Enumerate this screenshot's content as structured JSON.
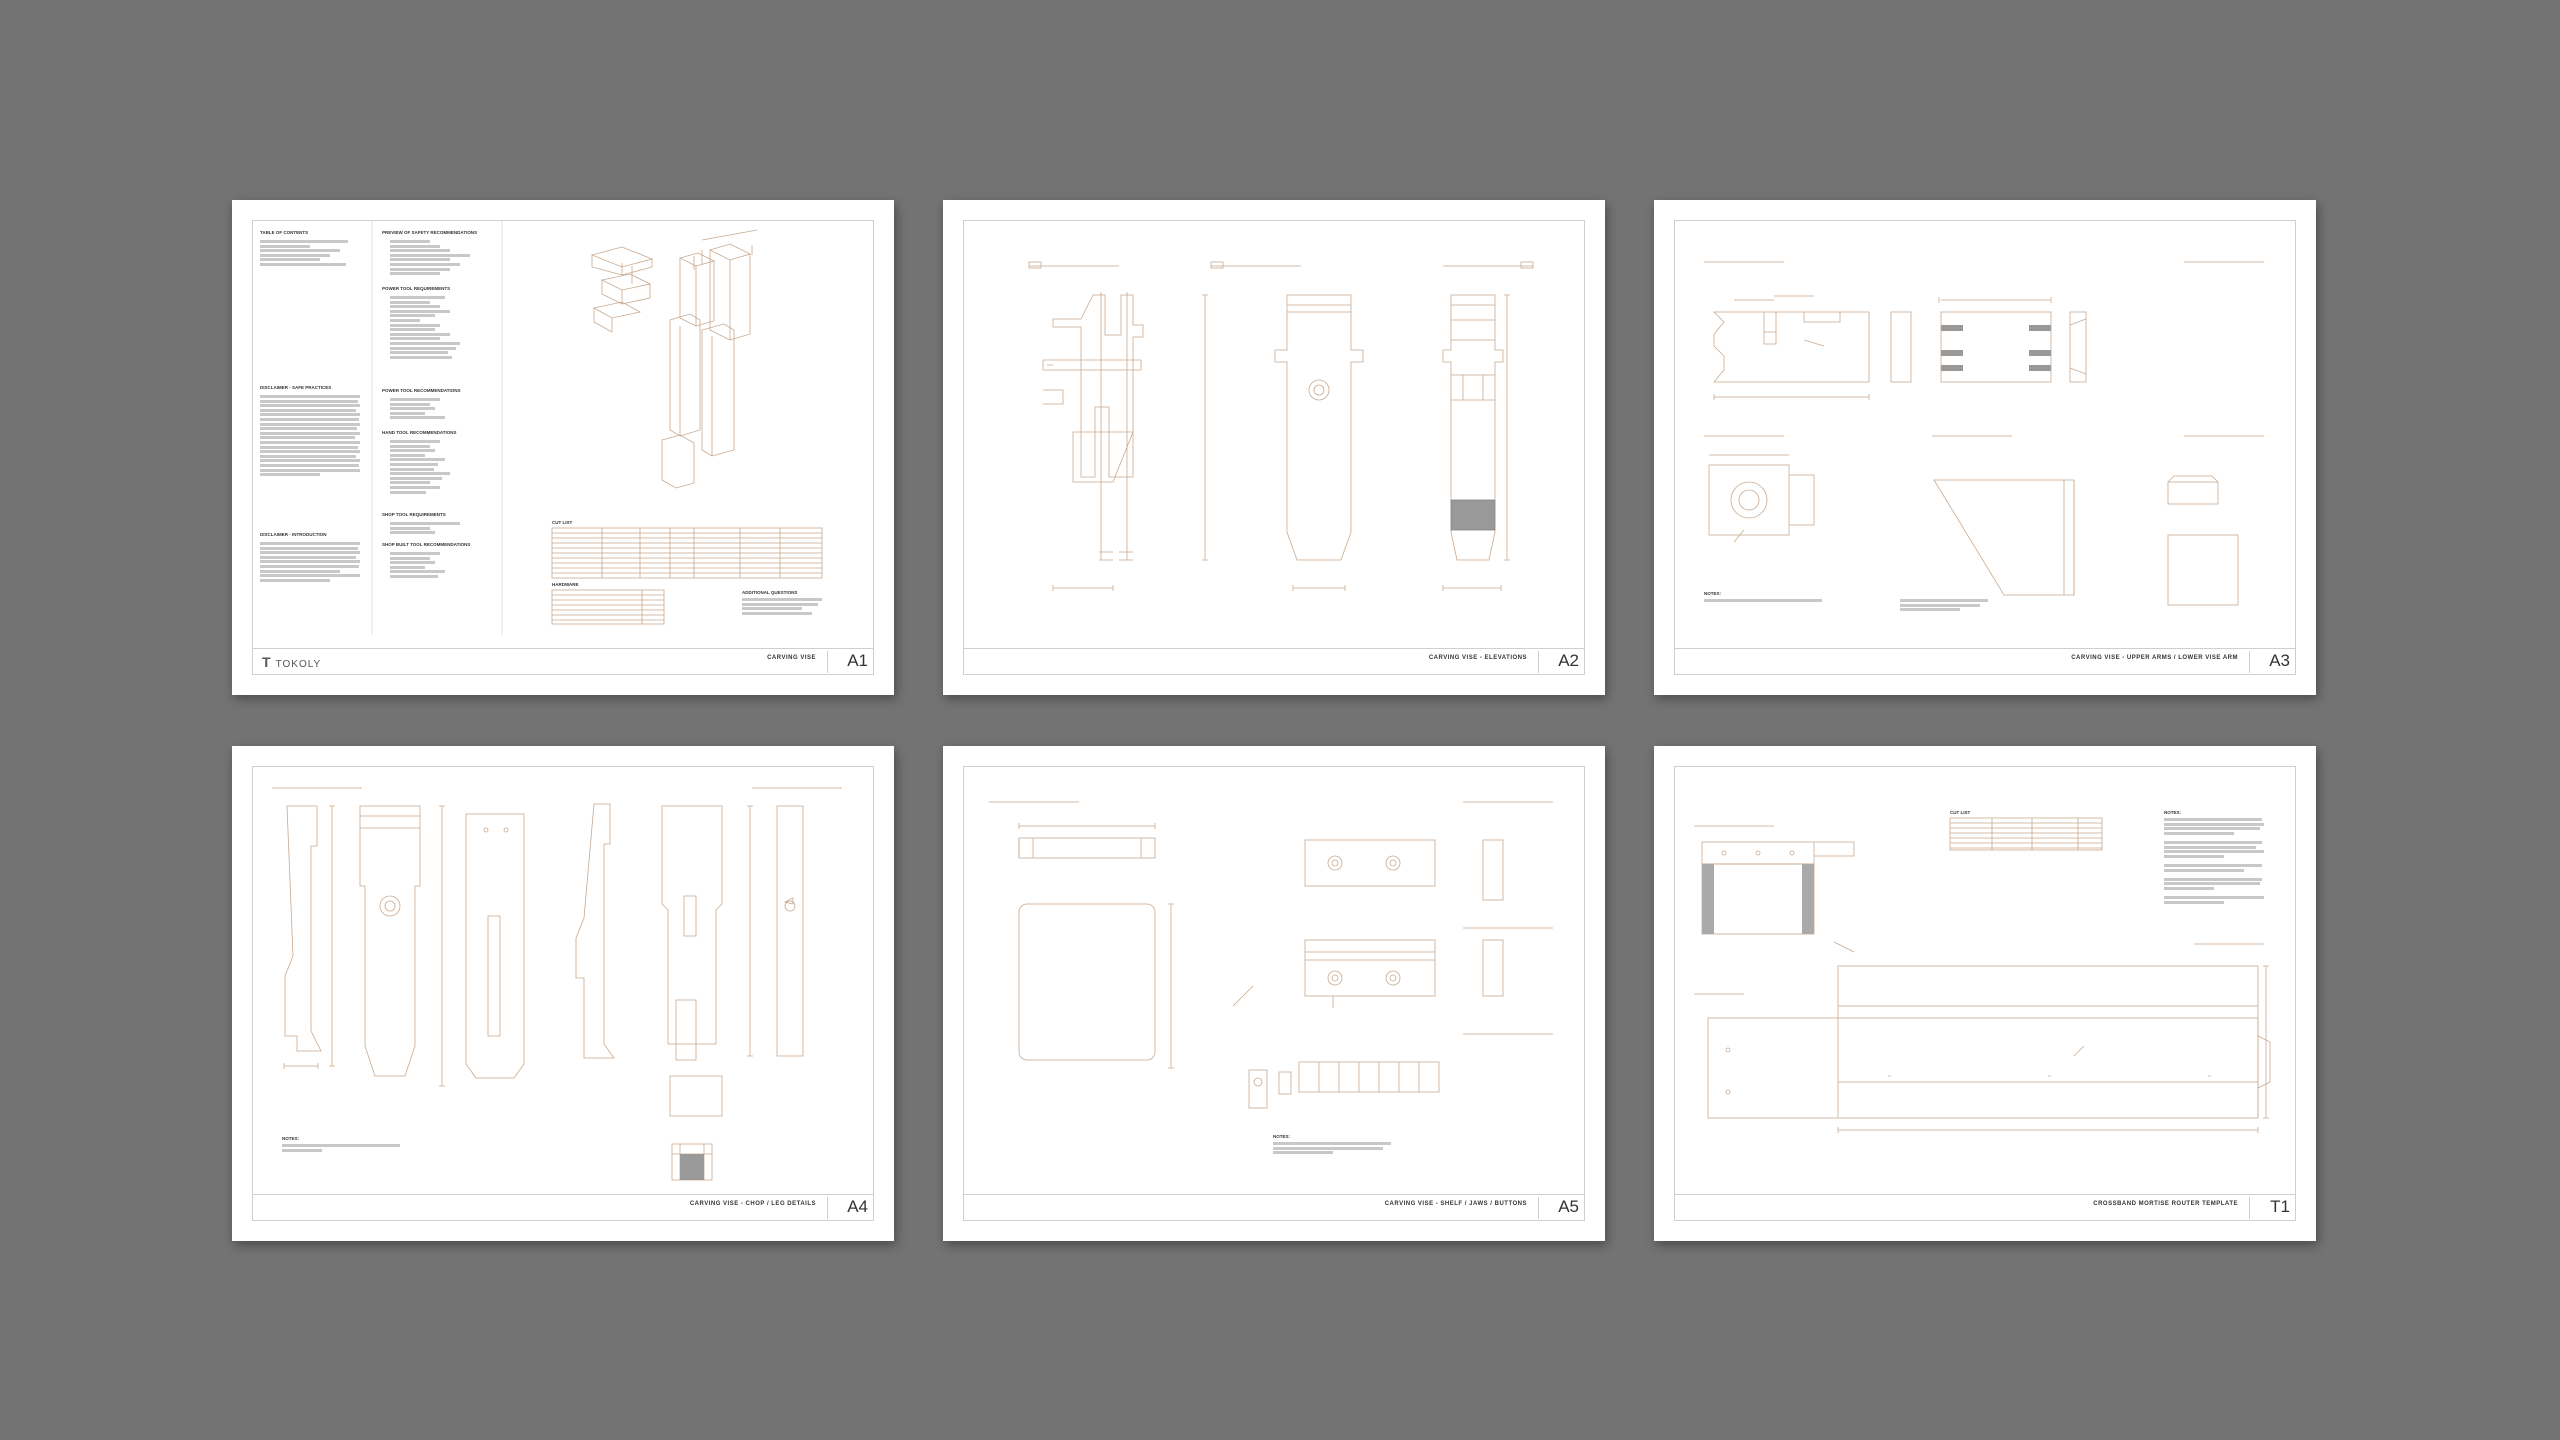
{
  "colors": {
    "background": "#737373",
    "sheet": "#ffffff",
    "line": "#c9a98e",
    "frame": "#cfcfcf"
  },
  "sheets": [
    {
      "number": "A1",
      "title": "CARVING VISE",
      "logo": "TOKOLY",
      "toc_heading": "TABLE OF CONTENTS",
      "headings": [
        "PREVIEW OF SAFETY RECOMMENDATIONS",
        "POWER TOOL REQUIREMENTS",
        "POWER TOOL RECOMMENDATIONS",
        "HAND TOOL RECOMMENDATIONS",
        "SHOP TOOL REQUIREMENTS",
        "SHOP BUILT TOOL RECOMMENDATIONS"
      ],
      "disclaimer_heading": "DISCLAIMER - SAFE PRACTICES",
      "intro_heading": "DISCLAIMER - INTRODUCTION",
      "cut_list_heading": "CUT LIST",
      "hardware_heading": "HARDWARE",
      "questions_heading": "ADDITIONAL QUESTIONS"
    },
    {
      "number": "A2",
      "title": "CARVING VISE - ELEVATIONS"
    },
    {
      "number": "A3",
      "title": "CARVING VISE - UPPER ARMS / LOWER VISE ARM",
      "notes_heading": "NOTES:"
    },
    {
      "number": "A4",
      "title": "CARVING VISE - CHOP / LEG DETAILS",
      "notes_heading": "NOTES:"
    },
    {
      "number": "A5",
      "title": "CARVING VISE - SHELF / JAWS / BUTTONS",
      "notes_heading": "NOTES:"
    },
    {
      "number": "T1",
      "title": "CROSSBAND MORTISE ROUTER TEMPLATE",
      "notes_heading": "NOTES:",
      "cut_list_heading": "CUT LIST"
    }
  ]
}
